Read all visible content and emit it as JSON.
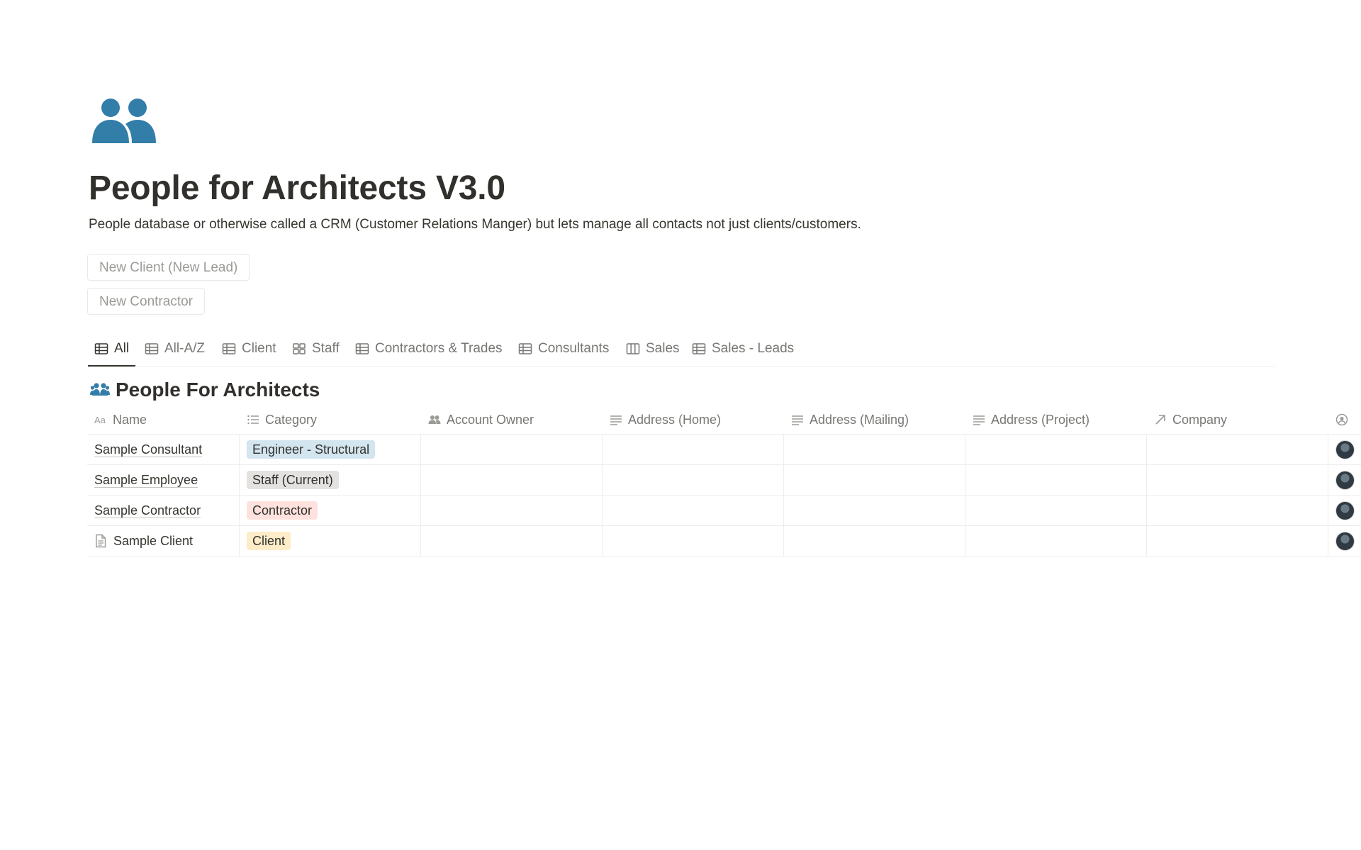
{
  "page": {
    "title": "People for Architects V3.0",
    "description": "People database or otherwise called a CRM (Customer Relations Manger) but lets manage all contacts not just clients/customers.",
    "icon": "people-icon",
    "icon_color": "#337ea9"
  },
  "buttons": {
    "new_client": "New Client (New Lead)",
    "new_contractor": "New Contractor"
  },
  "tabs": [
    {
      "label": "All",
      "icon": "table-icon",
      "active": true
    },
    {
      "label": "All-A/Z",
      "icon": "table-icon"
    },
    {
      "label": "Client",
      "icon": "table-icon"
    },
    {
      "label": "Staff",
      "icon": "gallery-icon"
    },
    {
      "label": "Contractors & Trades",
      "icon": "table-icon"
    },
    {
      "label": "Consultants",
      "icon": "table-icon"
    },
    {
      "label": "Sales",
      "icon": "board-icon"
    },
    {
      "label": "Sales - Leads",
      "icon": "table-icon"
    }
  ],
  "database": {
    "title": "People For Architects",
    "icon": "people-icon",
    "columns": [
      {
        "label": "Name",
        "icon": "title-icon"
      },
      {
        "label": "Category",
        "icon": "list-icon"
      },
      {
        "label": "Account Owner",
        "icon": "person-icon"
      },
      {
        "label": "Address (Home)",
        "icon": "text-icon"
      },
      {
        "label": "Address (Mailing)",
        "icon": "text-icon"
      },
      {
        "label": "Address (Project)",
        "icon": "text-icon"
      },
      {
        "label": "Company",
        "icon": "relation-icon"
      },
      {
        "label": "",
        "icon": "created-by-icon"
      }
    ],
    "rows": [
      {
        "name": "Sample Consultant",
        "category": "Engineer - Structural",
        "category_color": "#d3e5ef"
      },
      {
        "name": "Sample Employee",
        "category": "Staff (Current)",
        "category_color": "#e3e2e0"
      },
      {
        "name": "Sample Contractor",
        "category": "Contractor",
        "category_color": "#ffe2dd"
      },
      {
        "name": "Sample Client",
        "category": "Client",
        "category_color": "#fdecc8",
        "has_page_icon": true
      }
    ]
  }
}
